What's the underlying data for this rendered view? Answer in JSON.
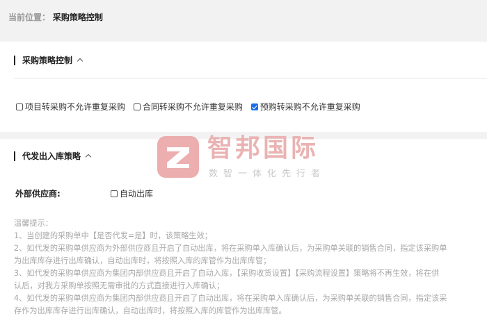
{
  "breadcrumb": {
    "label": "当前位置：",
    "current": "采购策略控制"
  },
  "section_purchase": {
    "title": "采购策略控制",
    "options": [
      {
        "label": "项目转采购不允许重复采购",
        "checked": false
      },
      {
        "label": "合同转采购不允许重复采购",
        "checked": false
      },
      {
        "label": "预购转采购不允许重复采购",
        "checked": true
      }
    ]
  },
  "section_dropship": {
    "title": "代发出入库策略",
    "supplier_label": "外部供应商:",
    "auto_label": "自动出库",
    "tips": [
      "温馨提示：",
      "1、当创建的采购单中【是否代发=是】时，该策略生效；",
      "2、如代发的采购单供应商为外部供应商且开启了自动出库，将在采购单入库确认后，为采购单关联的销售合同，指定该采购单",
      "为出库库存进行出库确认，自动出库时，将按照入库的库管作为出库库管；",
      "3、如代发的采购单供应商为集团内部供应商且开启了自动入库，【采购收货设置】【采购流程设置】策略将不再生效，将在供",
      "认后，对我方采购单按照无需审批的方式直接进行入库确认；",
      "4、如代发的采购单供应商为集团内部供应商且开启了自动出库，将在采购单入库确认后，为采购单关联的销售合同，指定该采",
      "存作为出库库存进行出库确认，自动出库时，将按照入库的库管作为出库库管。"
    ]
  },
  "watermark": {
    "title": "智邦国际",
    "subtitle": "数智一体化先行者",
    "color": "#e9a0a0"
  },
  "colors": {
    "accent": "#1a6fe8",
    "page_bg": "#f2f2f2"
  }
}
